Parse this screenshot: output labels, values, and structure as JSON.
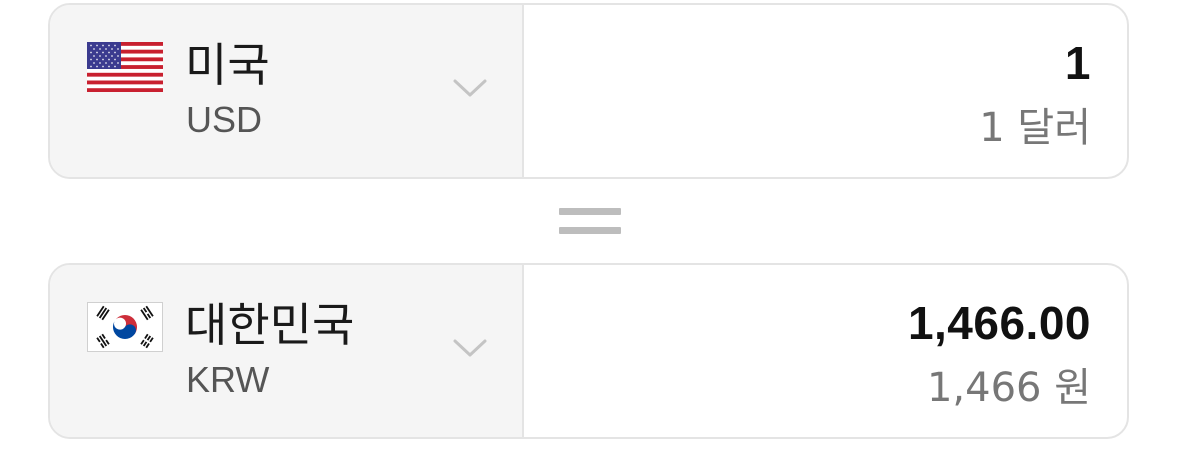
{
  "from": {
    "country": "미국",
    "code": "USD",
    "amount": "1",
    "amount_words": "1 달러",
    "flag_icon": "us-flag-icon"
  },
  "to": {
    "country": "대한민국",
    "code": "KRW",
    "amount": "1,466.00",
    "amount_words": "1,466 원",
    "flag_icon": "kr-flag-icon"
  },
  "colors": {
    "border": "#e4e4e4",
    "selector_bg": "#f5f5f5",
    "equals": "#bdbdbd"
  }
}
